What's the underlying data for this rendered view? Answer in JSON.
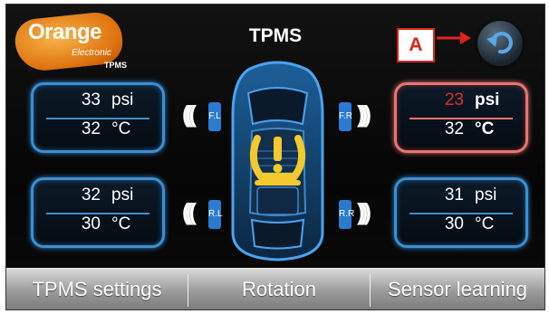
{
  "logo": {
    "main": "Orange",
    "sub1": "Electronic",
    "sub2": "TPMS"
  },
  "header": {
    "title": "TPMS"
  },
  "annotation": {
    "label": "A"
  },
  "back_button": {
    "icon": "back-arrow-icon"
  },
  "tires": {
    "front_left": {
      "pressure": "33",
      "pressure_unit": "psi",
      "temperature": "32",
      "temperature_unit": "°C",
      "label": "F.L",
      "alert": false
    },
    "front_right": {
      "pressure": "23",
      "pressure_unit": "psi",
      "temperature": "32",
      "temperature_unit": "°C",
      "label": "F.R",
      "alert": true
    },
    "rear_left": {
      "pressure": "32",
      "pressure_unit": "psi",
      "temperature": "30",
      "temperature_unit": "°C",
      "label": "R.L",
      "alert": false
    },
    "rear_right": {
      "pressure": "31",
      "pressure_unit": "psi",
      "temperature": "30",
      "temperature_unit": "°C",
      "label": "R.R",
      "alert": false
    }
  },
  "footer": {
    "settings_label": "TPMS settings",
    "rotation_label": "Rotation",
    "learning_label": "Sensor learning"
  },
  "colors": {
    "accent_blue": "#3c8fd0",
    "alert_red": "#e52a26",
    "warning_yellow": "#f3c92d",
    "annotation_red": "#e0221c"
  }
}
